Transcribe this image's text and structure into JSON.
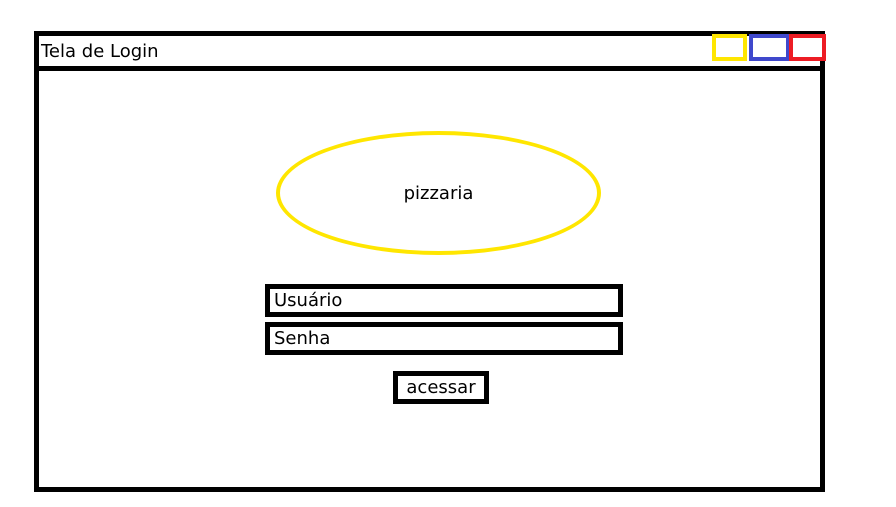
{
  "window": {
    "title": "Tela de Login"
  },
  "controls": {
    "minimize_color": "#ffe600",
    "maximize_color": "#3f48cc",
    "close_color": "#ed1c24"
  },
  "logo": {
    "text": "pizzaria",
    "color": "#ffe600"
  },
  "form": {
    "username_placeholder": "Usuário",
    "password_placeholder": "Senha",
    "submit_label": "acessar"
  }
}
